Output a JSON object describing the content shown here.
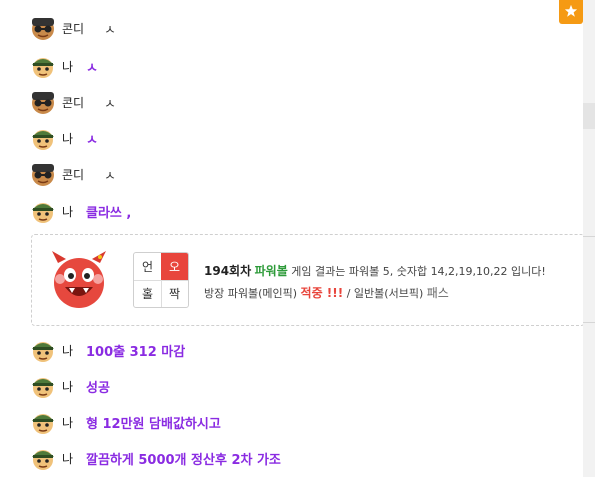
{
  "messages": [
    {
      "who": "other",
      "nick": "콘디",
      "text": "ㅅ",
      "style": "plain"
    },
    {
      "who": "me",
      "nick": "나",
      "text": "ㅅ",
      "style": "bold"
    },
    {
      "who": "other",
      "nick": "콘디",
      "text": "ㅅ",
      "style": "plain"
    },
    {
      "who": "me",
      "nick": "나",
      "text": "ㅅ",
      "style": "bold"
    },
    {
      "who": "other",
      "nick": "콘디",
      "text": "ㅅ",
      "style": "plain"
    },
    {
      "who": "me",
      "nick": "나",
      "text": "클라쓰 ,",
      "style": "bold"
    }
  ],
  "result_card": {
    "grid": [
      "언",
      "오",
      "홀",
      "짝"
    ],
    "highlighted": "오",
    "round": "194회차",
    "game": "파워볼",
    "line1_rest": "게임 결과는 파워볼 5, 숫자합 14,2,19,10,22 입니다!",
    "line2_a": "방장 파워볼(메인픽)",
    "line2_hit": "적중 !!!",
    "line2_b": "/ 일반볼(서브픽)",
    "line2_pass": "패스"
  },
  "messages_after": [
    {
      "who": "me",
      "nick": "나",
      "text": "100출 312 마감"
    },
    {
      "who": "me",
      "nick": "나",
      "text": "성공"
    },
    {
      "who": "me",
      "nick": "나",
      "text": "형 12만원 담배값하시고"
    },
    {
      "who": "me",
      "nick": "나",
      "text": "깔끔하게 5000개 정산후 2차 가조"
    }
  ],
  "colors": {
    "accent_purple": "#8a2be2",
    "hit_red": "#e8453c",
    "game_green": "#2e9b3a",
    "star_orange": "#f59a14"
  },
  "icons": {
    "star_button": "star-icon",
    "devil_avatar": "devil-icon"
  }
}
